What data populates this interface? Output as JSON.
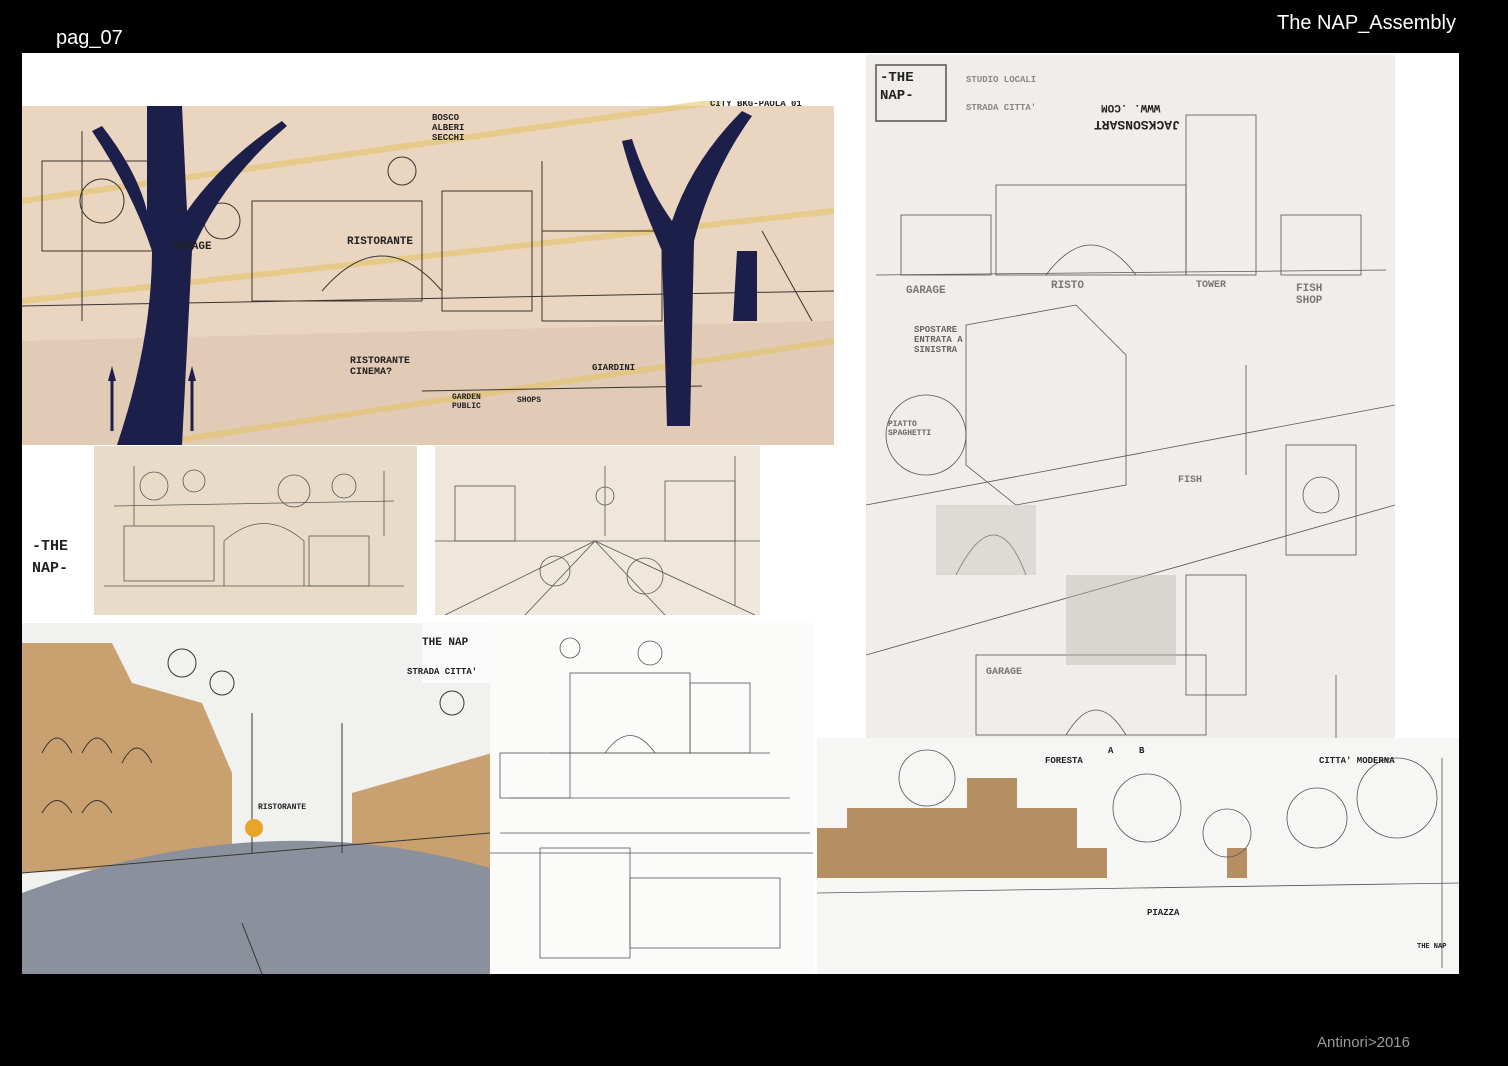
{
  "header": {
    "page_label": "pag_07",
    "title": "The NAP_Assembly"
  },
  "footer": {
    "credit": "Antinori>2016"
  },
  "colors": {
    "background": "#000000",
    "board": "#ffffff",
    "paper_warm": "#e9d3bf",
    "tree_navy": "#1c1f4a",
    "ochre": "#c9a070",
    "asphalt": "#8a919c"
  },
  "panels": {
    "top_left": {
      "labels": [
        "CITY BKG-PAOLA 01",
        "BOSCO ALBERI SECCHI",
        "GARAGE",
        "RISTORANTE",
        "RISTORANTE CINEMA?",
        "GARDEN PUBLIC",
        "SHOPS",
        "GIARDINI"
      ]
    },
    "logo_side": {
      "text": "-THE NAP-"
    },
    "right_sketch": {
      "logo": "-THE NAP-",
      "notes": [
        "STUDIO LOCALI",
        "STRADA CITTA'",
        "JACKSONSART",
        "WWW. .COM",
        "GARAGE",
        "RISTO",
        "TOWER",
        "FISH SHOP",
        "SPOSTARE ENTRATA A SINISTRA",
        "PIATTO SPAGHETTI",
        "FISH",
        "GARAGE"
      ]
    },
    "bottom_left": {
      "labels": [
        "THE NAP",
        "STRADA CITTA'",
        "RISTORANTE"
      ]
    },
    "bottom_right": {
      "labels": [
        "FORESTA",
        "A",
        "B",
        "CITTA' MODERNA",
        "PIAZZA",
        "THE NAP"
      ]
    }
  }
}
